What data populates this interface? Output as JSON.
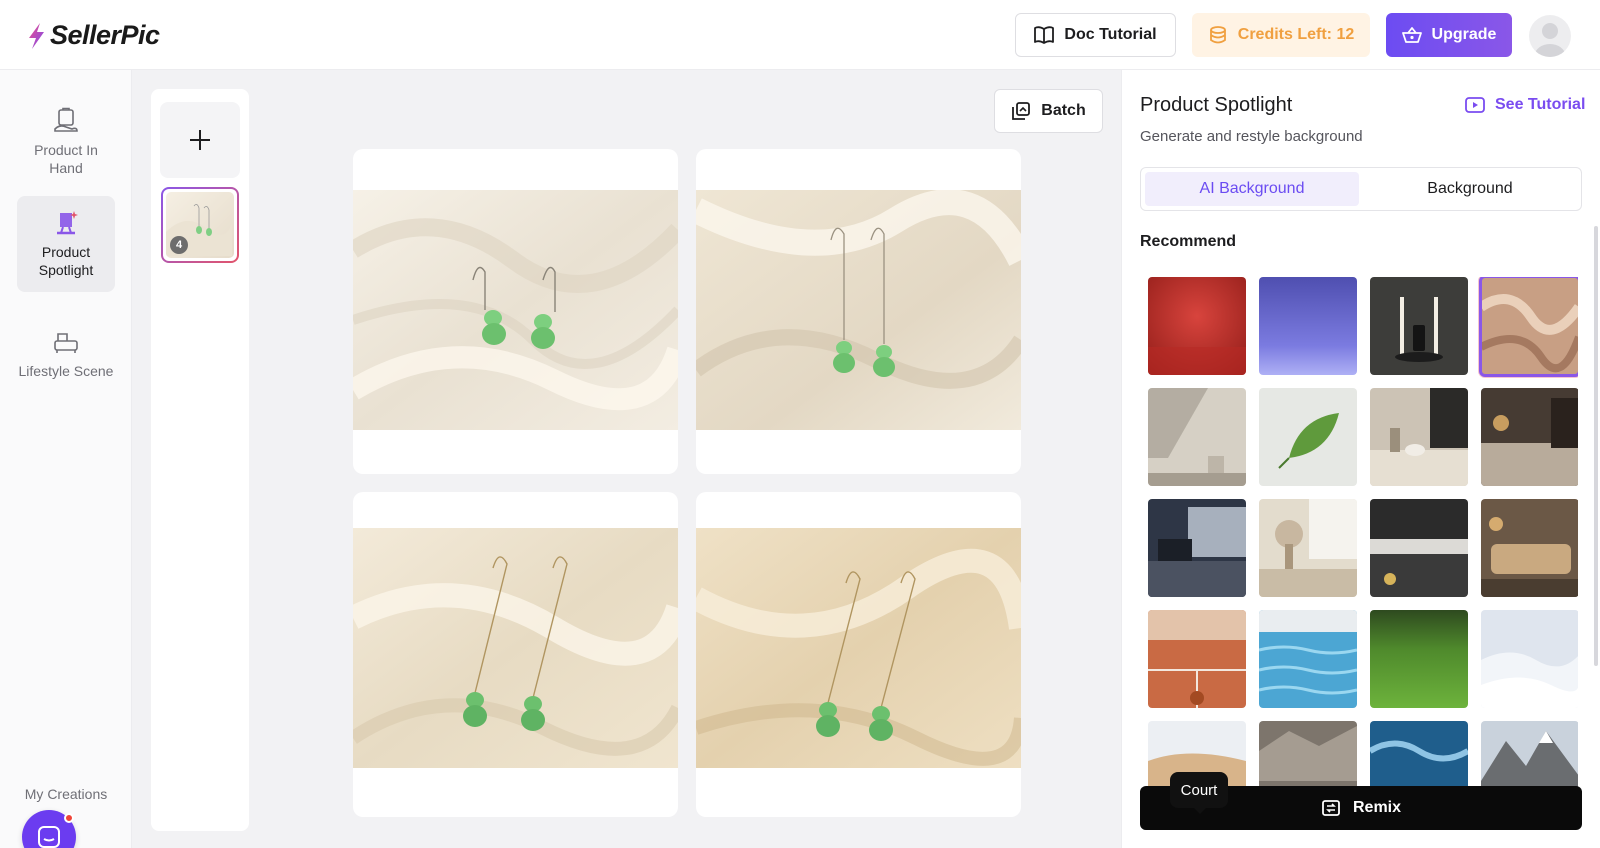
{
  "app": {
    "name": "SellerPic"
  },
  "header": {
    "doc_tutorial": "Doc Tutorial",
    "credits": "Credits Left: 12",
    "upgrade": "Upgrade"
  },
  "nav": {
    "items": [
      {
        "label": "Product In Hand",
        "icon": "hand-bag-icon",
        "active": false
      },
      {
        "label": "Product Spotlight",
        "icon": "spotlight-icon",
        "active": true
      },
      {
        "label": "Lifestyle Scene",
        "icon": "sofa-icon",
        "active": false
      }
    ],
    "my_creations": "My Creations"
  },
  "strip": {
    "thumb_count": "4"
  },
  "canvas": {
    "batch_label": "Batch"
  },
  "panel": {
    "title": "Product Spotlight",
    "subtitle": "Generate and restyle background",
    "see_tutorial": "See Tutorial",
    "tabs": [
      {
        "label": "AI Background",
        "active": true
      },
      {
        "label": "Background",
        "active": false
      }
    ],
    "recommend_label": "Recommend",
    "tooltip": "Court",
    "remix": "Remix",
    "tiles": [
      "red-studio",
      "blue-studio",
      "dark-pedestal",
      "silk-fabric",
      "shadow-wall",
      "green-leaf",
      "kitchen-table",
      "cozy-bedroom",
      "office-desk",
      "flower-table",
      "kitchen-counter",
      "living-sofa",
      "tennis-court",
      "pool-water",
      "green-grass",
      "snow-field",
      "sand-dunes",
      "rocks",
      "ocean-wave",
      "mountain-range"
    ],
    "selected_tile": "silk-fabric"
  },
  "colors": {
    "accent": "#6b4cf2",
    "credits": "#f0a040",
    "remix_bg": "#0a0a0a"
  }
}
